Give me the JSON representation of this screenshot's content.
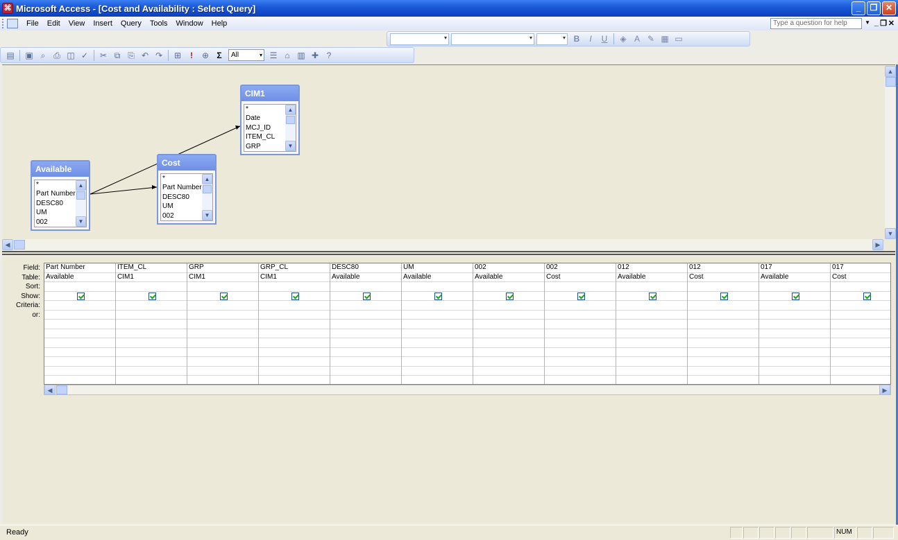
{
  "window": {
    "title": "Microsoft Access - [Cost and Availability : Select Query]"
  },
  "menu": {
    "items": [
      "File",
      "Edit",
      "View",
      "Insert",
      "Query",
      "Tools",
      "Window",
      "Help"
    ],
    "help_placeholder": "Type a question for help"
  },
  "toolbar": {
    "top_values_combo": "All"
  },
  "tables": [
    {
      "name": "CIM1",
      "fields": [
        "*",
        "Date",
        "MCJ_ID",
        "ITEM_CL",
        "GRP"
      ]
    },
    {
      "name": "Cost",
      "fields": [
        "*",
        "Part Number",
        "DESC80",
        "UM",
        "002"
      ]
    },
    {
      "name": "Available",
      "fields": [
        "*",
        "Part Number",
        "DESC80",
        "UM",
        "002"
      ]
    }
  ],
  "grid": {
    "row_labels": [
      "Field:",
      "Table:",
      "Sort:",
      "Show:",
      "Criteria:",
      "or:"
    ],
    "columns": [
      {
        "field": "Part Number",
        "table": "Available",
        "show": true
      },
      {
        "field": "ITEM_CL",
        "table": "CIM1",
        "show": true
      },
      {
        "field": "GRP",
        "table": "CIM1",
        "show": true
      },
      {
        "field": "GRP_CL",
        "table": "CIM1",
        "show": true
      },
      {
        "field": "DESC80",
        "table": "Available",
        "show": true
      },
      {
        "field": "UM",
        "table": "Available",
        "show": true
      },
      {
        "field": "002",
        "table": "Available",
        "show": true
      },
      {
        "field": "002",
        "table": "Cost",
        "show": true
      },
      {
        "field": "012",
        "table": "Available",
        "show": true
      },
      {
        "field": "012",
        "table": "Cost",
        "show": true
      },
      {
        "field": "017",
        "table": "Available",
        "show": true
      },
      {
        "field": "017",
        "table": "Cost",
        "show": true
      }
    ]
  },
  "status": {
    "text": "Ready",
    "num": "NUM"
  }
}
